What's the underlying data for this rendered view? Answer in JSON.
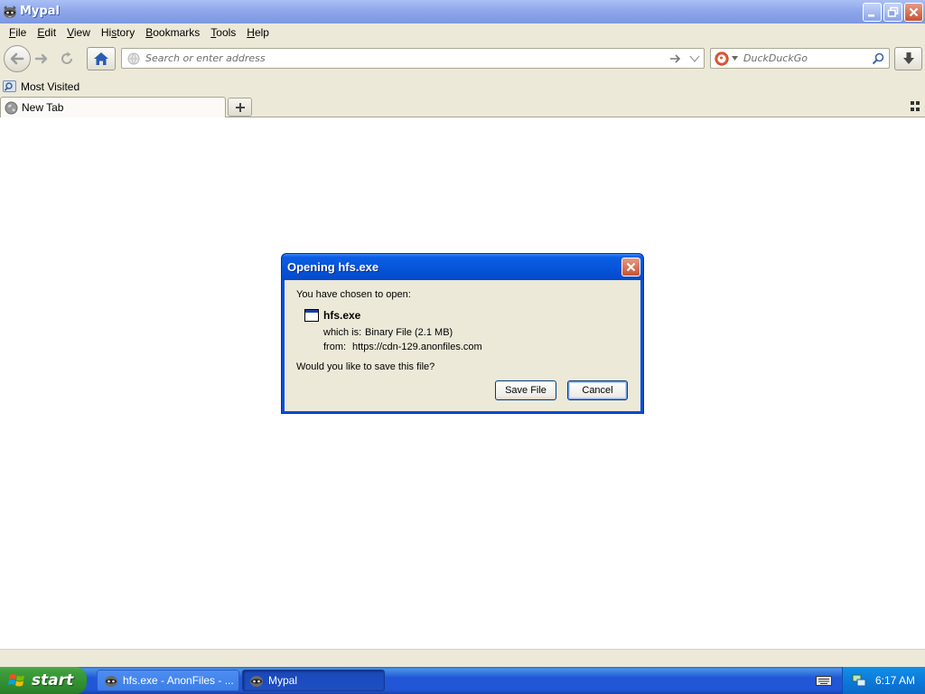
{
  "window": {
    "title": "Mypal"
  },
  "menu": {
    "items": [
      {
        "pre": "",
        "acc": "F",
        "post": "ile"
      },
      {
        "pre": "",
        "acc": "E",
        "post": "dit"
      },
      {
        "pre": "",
        "acc": "V",
        "post": "iew"
      },
      {
        "pre": "Hi",
        "acc": "s",
        "post": "tory"
      },
      {
        "pre": "",
        "acc": "B",
        "post": "ookmarks"
      },
      {
        "pre": "",
        "acc": "T",
        "post": "ools"
      },
      {
        "pre": "",
        "acc": "H",
        "post": "elp"
      }
    ]
  },
  "navbar": {
    "url_placeholder": "Search or enter address",
    "search_placeholder": "DuckDuckGo"
  },
  "bookmarks": {
    "most_visited": "Most Visited"
  },
  "tabs": {
    "active_label": "New Tab"
  },
  "dialog": {
    "title": "Opening hfs.exe",
    "intro": "You have chosen to open:",
    "filename": "hfs.exe",
    "which_label": "which is:",
    "which_value": "Binary File (2.1 MB)",
    "from_label": "from:",
    "from_value": "https://cdn-129.anonfiles.com",
    "question": "Would you like to save this file?",
    "save_label": "Save File",
    "cancel_label": "Cancel"
  },
  "taskbar": {
    "start_label": "start",
    "task1_label": "hfs.exe - AnonFiles - ...",
    "task2_label": "Mypal",
    "clock": "6:17 AM"
  },
  "colors": {
    "xp_blue": "#0a4fd8",
    "xp_green": "#3c9c3a",
    "chrome_beige": "#ece9d8"
  }
}
